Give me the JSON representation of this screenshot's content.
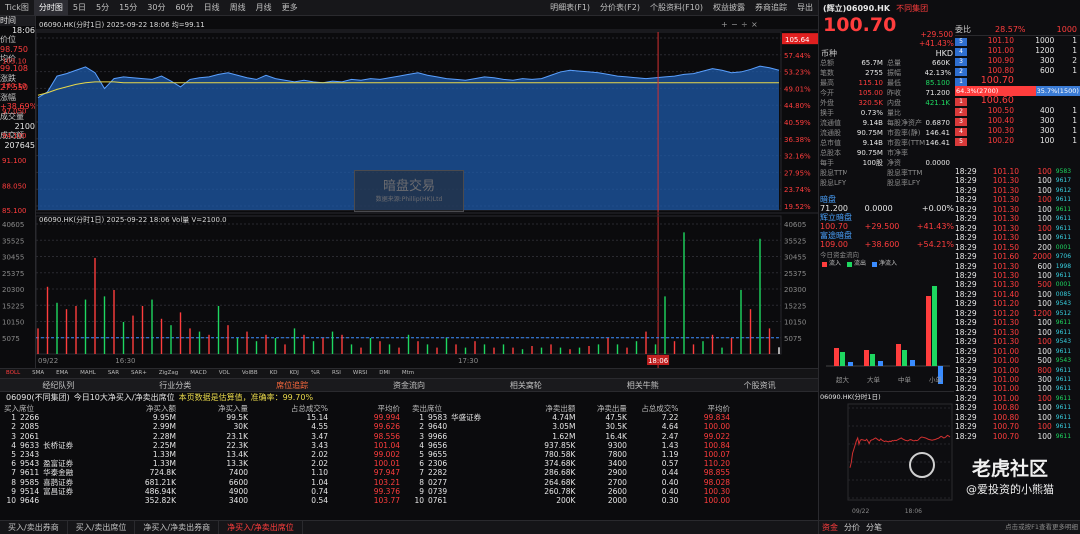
{
  "topbar": {
    "left": [
      "Tick图",
      "分时图",
      "5日",
      "5分",
      "15分",
      "30分",
      "60分",
      "日线",
      "周线",
      "月线",
      "更多"
    ],
    "right": [
      "明细表(F1)",
      "分价表(F2)",
      "个股资料(F10)",
      "权益披露",
      "券商追踪",
      "导出"
    ]
  },
  "sidebar": {
    "time": "时间",
    "price_label": "价位",
    "price": "98.750",
    "avg_label": "均价",
    "avg": "99.108",
    "change_label": "涨跌",
    "change": "27.550",
    "pct_label": "涨幅",
    "pct": "+38.69%",
    "vol_label": "成交量",
    "vol": "2100",
    "amt_label": "成交额",
    "amt": "207645"
  },
  "chart_title": "06090.HK(分时1日) 2025-09-22 18:06 均=99.11",
  "chart_time": "18:06",
  "vol_title": "06090.HK(分时1日) 2025-09-22 18:06 Vol量 V=2100.0",
  "watermark": {
    "title": "暗盘交易",
    "sub": "数据来源:Phillip(HK)Ltd"
  },
  "chart_data": {
    "type": "line",
    "x_labels": [
      "09/22",
      "16:30",
      "17:30",
      "18:06"
    ],
    "price_ticks": [
      "85.100",
      "88.050",
      "91.100",
      "94.100",
      "97.050",
      "100.10",
      "103.10"
    ],
    "pct_ticks": [
      "61.66%",
      "57.44%",
      "53.23%",
      "49.01%",
      "44.80%",
      "40.59%",
      "36.38%",
      "32.16%",
      "27.95%",
      "23.74%",
      "19.52%"
    ],
    "vol_ticks": [
      "40605",
      "35525",
      "30455",
      "25375",
      "20300",
      "15225",
      "10150",
      "5075"
    ],
    "vol_ticks_left": [
      "40605",
      "35525",
      "30455",
      "25375",
      "20300",
      "15225",
      "10150",
      "5075"
    ],
    "last_price": "105.64",
    "ylim": [
      85.1,
      106.5
    ],
    "price": [
      98.6,
      99.3,
      101.2,
      101.5,
      101.9,
      102.3,
      101.6,
      99.7,
      100.9,
      101.1,
      101.0,
      100.9,
      100.8,
      101.2,
      100.6,
      99.9,
      100.8,
      101.0,
      101.1,
      101.4,
      101.6,
      101.3,
      101.0,
      100.8,
      101.3,
      100.9,
      100.7,
      100.5,
      100.7,
      100.5,
      100.4,
      100.6,
      100.5,
      100.8,
      100.7,
      100.9,
      100.8,
      101.0,
      101.2,
      101.4,
      101.6,
      101.3,
      101.1,
      100.9,
      100.8,
      100.7,
      100.9,
      101.1,
      101.0,
      100.8,
      100.7,
      100.9,
      100.8,
      100.9,
      101.3,
      101.7,
      101.9,
      101.8,
      101.7,
      101.6,
      101.4,
      101.2,
      101.1,
      101.0,
      100.9,
      101.0,
      101.1,
      101.2,
      101.4,
      101.5,
      101.8,
      102.1,
      101.9,
      101.6,
      101.7,
      102.0,
      102.4,
      102.2,
      101.9
    ],
    "avg": [
      98.9,
      99.2,
      99.6,
      99.9,
      100.2,
      100.4,
      100.5,
      100.5,
      100.5,
      100.4,
      100.4,
      100.4,
      100.4,
      100.4,
      100.4,
      100.4,
      100.4,
      100.4,
      100.4,
      100.4,
      100.4,
      100.4,
      100.4,
      100.4,
      100.4,
      100.4,
      100.4,
      100.4,
      100.4,
      100.4,
      100.4,
      100.4,
      100.4,
      100.4,
      100.4,
      100.4,
      100.4,
      100.4,
      100.4,
      100.4,
      100.4,
      100.4,
      100.4,
      100.4,
      100.4,
      100.4,
      100.4,
      100.4,
      100.4,
      100.4,
      100.4,
      100.4,
      100.4,
      100.4,
      100.4,
      100.4,
      100.4,
      100.4,
      100.4,
      100.4,
      100.4,
      100.4,
      100.4,
      100.4,
      100.4,
      100.4,
      100.4,
      100.4,
      100.4,
      100.4,
      100.4,
      100.4,
      100.4,
      100.4,
      100.4,
      100.4,
      100.4,
      100.4,
      100.4
    ],
    "volume": [
      8000,
      21000,
      16000,
      14000,
      15000,
      17000,
      30000,
      18000,
      20000,
      10000,
      12000,
      15000,
      17000,
      11000,
      9000,
      13000,
      8000,
      7000,
      6000,
      15000,
      9000,
      5000,
      7000,
      4000,
      6000,
      5000,
      3000,
      8000,
      6000,
      4000,
      5000,
      7000,
      6000,
      3000,
      2000,
      5000,
      4000,
      3000,
      2000,
      6000,
      4000,
      3000,
      2000,
      5000,
      3000,
      2000,
      4000,
      3000,
      2000,
      3000,
      2000,
      1500,
      2500,
      2000,
      3000,
      2000,
      1500,
      2000,
      2500,
      3000,
      5000,
      3000,
      2000,
      4000,
      7000,
      3000,
      18000,
      4000,
      38000,
      3000,
      4000,
      6000,
      2000,
      5000,
      20000,
      14000,
      36000,
      8000,
      2100
    ],
    "vol_up": [
      1,
      1,
      0,
      1,
      1,
      0,
      1,
      0,
      1,
      0,
      1,
      1,
      0,
      1,
      0,
      1,
      1,
      0,
      1,
      0,
      1,
      0,
      1,
      0,
      1,
      0,
      1,
      0,
      1,
      0,
      1,
      0,
      1,
      0,
      1,
      0,
      1,
      0,
      1,
      0,
      1,
      0,
      1,
      0,
      1,
      0,
      1,
      0,
      1,
      0,
      1,
      0,
      1,
      0,
      1,
      0,
      1,
      0,
      1,
      0,
      1,
      0,
      1,
      0,
      1,
      0,
      0,
      1,
      0,
      1,
      0,
      1,
      0,
      1,
      0,
      1,
      0,
      1,
      1
    ]
  },
  "indicators": [
    "BOLL",
    "SMA",
    "EMA",
    "MAHL",
    "SAR",
    "SAR+",
    "ZigZag",
    "MACD",
    "VOL",
    "VolBB",
    "KD",
    "KDJ",
    "%R",
    "RSI",
    "WRSI",
    "DMI",
    "Mtm"
  ],
  "tabs2": [
    "经纪队列",
    "行业分类",
    "席位追踪",
    "资金流向",
    "相关窝轮",
    "相关牛熊",
    "个股资讯"
  ],
  "broker_header": {
    "prefix": "06090(不同集团)",
    "mid": "今日10大净买入/净卖出席位",
    "note": "本页数据是估算值，准确率：",
    "rate": "99.70%"
  },
  "buy_table": {
    "headers": [
      "买入席位",
      "净买入额",
      "净买入量",
      "占总成交%",
      "平均价"
    ],
    "rows": [
      [
        "1",
        "2266",
        "",
        "9.95M",
        "99.5K",
        "15.14",
        "99.994"
      ],
      [
        "2",
        "2085",
        "",
        "2.99M",
        "30K",
        "4.55",
        "99.626"
      ],
      [
        "3",
        "2061",
        "",
        "2.28M",
        "23.1K",
        "3.47",
        "98.556"
      ],
      [
        "4",
        "9633",
        "长桥证券",
        "2.25M",
        "22.3K",
        "3.43",
        "101.04"
      ],
      [
        "5",
        "2343",
        "",
        "1.33M",
        "13.4K",
        "2.02",
        "99.002"
      ],
      [
        "6",
        "9543",
        "盈富证券",
        "1.33M",
        "13.3K",
        "2.02",
        "100.01"
      ],
      [
        "7",
        "9611",
        "华泰金融",
        "724.8K",
        "7400",
        "1.10",
        "97.947"
      ],
      [
        "8",
        "9585",
        "喜鹊证券",
        "681.21K",
        "6600",
        "1.04",
        "103.21"
      ],
      [
        "9",
        "9514",
        "富昌证券",
        "486.94K",
        "4900",
        "0.74",
        "99.376"
      ],
      [
        "10",
        "9646",
        "",
        "352.82K",
        "3400",
        "0.54",
        "103.77"
      ]
    ]
  },
  "sell_table": {
    "headers": [
      "卖出席位",
      "净卖出额",
      "净卖出量",
      "占总成交%",
      "平均价"
    ],
    "rows": [
      [
        "1",
        "9583",
        "华盛证券",
        "4.74M",
        "47.5K",
        "7.22",
        "99.834"
      ],
      [
        "2",
        "9640",
        "",
        "3.05M",
        "30.5K",
        "4.64",
        "100.00"
      ],
      [
        "3",
        "9966",
        "",
        "1.62M",
        "16.4K",
        "2.47",
        "99.022"
      ],
      [
        "4",
        "9656",
        "",
        "937.85K",
        "9300",
        "1.43",
        "100.84"
      ],
      [
        "5",
        "9655",
        "",
        "780.58K",
        "7800",
        "1.19",
        "100.07"
      ],
      [
        "6",
        "2306",
        "",
        "374.68K",
        "3400",
        "0.57",
        "110.20"
      ],
      [
        "7",
        "2282",
        "",
        "286.68K",
        "2900",
        "0.44",
        "98.855"
      ],
      [
        "8",
        "0277",
        "",
        "264.68K",
        "2700",
        "0.40",
        "98.028"
      ],
      [
        "9",
        "0739",
        "",
        "260.78K",
        "2600",
        "0.40",
        "100.30"
      ],
      [
        "10",
        "0761",
        "",
        "200K",
        "2000",
        "0.30",
        "100.00"
      ]
    ]
  },
  "bottom_tabs": [
    "买入/卖出券商",
    "买入/卖出席位",
    "净买入/净卖出券商",
    "净买入/净卖出席位"
  ],
  "quote": {
    "name": "(辉立)06090.HK",
    "group": "不同集团",
    "price": "100.70",
    "chg": "+29.500",
    "pct": "+41.43%",
    "currency_label": "币种",
    "currency": "HKD",
    "stats": [
      [
        "总额",
        "65.7M",
        "总量",
        "660K"
      ],
      [
        "笔数",
        "2755",
        "振幅",
        "42.13%"
      ],
      [
        "最高",
        "115.10",
        "最低",
        "85.100"
      ],
      [
        "今开",
        "105.00",
        "昨收",
        "71.200"
      ],
      [
        "外盘",
        "320.5K",
        "内盘",
        "421.1K"
      ],
      [
        "换手",
        "0.73%",
        "量比",
        ""
      ],
      [
        "流通值",
        "9.14B",
        "每股净资产",
        "0.6870"
      ],
      [
        "流通股",
        "90.75M",
        "市盈率(静)",
        "146.41"
      ],
      [
        "总市值",
        "9.14B",
        "市盈率(TTM)",
        "146.41"
      ],
      [
        "总股本",
        "90.75M",
        "市净率",
        ""
      ],
      [
        "每手",
        "100股",
        "净资",
        "0.0000"
      ],
      [
        "股息TTM",
        "",
        "股息率TTM",
        ""
      ],
      [
        "股息LFY",
        "",
        "股息率LFY",
        ""
      ]
    ]
  },
  "dark": {
    "h1": "暗盘",
    "r1": [
      "71.200",
      "0.0000",
      "+0.00%"
    ],
    "h2": "辉立暗盘",
    "r2": [
      "100.70",
      "+29.500",
      "+41.43%"
    ],
    "h3": "富途暗盘",
    "r3": [
      "109.00",
      "+38.600",
      "+54.21%"
    ]
  },
  "flow": {
    "title": "今日资金流向",
    "legend": [
      "流入",
      "流出",
      "净流入"
    ],
    "labels": [
      "超大",
      "大单",
      "中单",
      "小单"
    ]
  },
  "mini_title": "06090.HK(分时1日)",
  "mini_x": [
    "09/22",
    "18:06"
  ],
  "orderbook": {
    "sell_label": "委比",
    "sell_pct": "28.57%",
    "sell_diff": "1000",
    "asks": [
      [
        "5",
        "101.10",
        "1000",
        "1"
      ],
      [
        "4",
        "101.00",
        "1200",
        "1"
      ],
      [
        "3",
        "100.90",
        "300",
        "2"
      ],
      [
        "2",
        "100.80",
        "600",
        "1"
      ],
      [
        "1",
        "100.70",
        "",
        ""
      ]
    ],
    "bid_pct": "64.3%(2700)",
    "ask_pct": "35.7%(1500)",
    "bids": [
      [
        "1",
        "100.60",
        "",
        ""
      ],
      [
        "2",
        "100.50",
        "400",
        "1"
      ],
      [
        "3",
        "100.40",
        "300",
        "1"
      ],
      [
        "4",
        "100.30",
        "300",
        "1"
      ],
      [
        "5",
        "100.20",
        "100",
        "1"
      ]
    ]
  },
  "ticks": [
    [
      "18:29",
      "101.10",
      "100",
      "9583"
    ],
    [
      "18:29",
      "101.30",
      "100",
      "9617"
    ],
    [
      "18:29",
      "101.30",
      "100",
      "9612"
    ],
    [
      "18:29",
      "101.30",
      "100",
      "9611"
    ],
    [
      "18:29",
      "101.30",
      "100",
      "9611"
    ],
    [
      "18:29",
      "101.30",
      "100",
      "9611"
    ],
    [
      "18:29",
      "101.30",
      "100",
      "9611"
    ],
    [
      "18:29",
      "101.30",
      "100",
      "9611"
    ],
    [
      "18:29",
      "101.50",
      "200",
      "0001"
    ],
    [
      "18:29",
      "101.60",
      "2000",
      "9706"
    ],
    [
      "18:29",
      "101.30",
      "600",
      "1998"
    ],
    [
      "18:29",
      "101.30",
      "100",
      "9611"
    ],
    [
      "18:29",
      "101.30",
      "500",
      "0001"
    ],
    [
      "18:29",
      "101.40",
      "100",
      "0085"
    ],
    [
      "18:29",
      "101.20",
      "100",
      "9543"
    ],
    [
      "18:29",
      "101.20",
      "1200",
      "9512"
    ],
    [
      "18:29",
      "101.30",
      "100",
      "9611"
    ],
    [
      "18:29",
      "101.30",
      "100",
      "9611"
    ],
    [
      "18:29",
      "101.30",
      "100",
      "9543"
    ],
    [
      "18:29",
      "101.00",
      "100",
      "9611"
    ],
    [
      "18:29",
      "101.00",
      "500",
      "9543"
    ],
    [
      "18:29",
      "101.00",
      "800",
      "9611"
    ],
    [
      "18:29",
      "101.00",
      "300",
      "9611"
    ],
    [
      "18:29",
      "101.00",
      "100",
      "9611"
    ],
    [
      "18:29",
      "101.00",
      "100",
      "9611"
    ],
    [
      "18:29",
      "100.80",
      "100",
      "9611"
    ],
    [
      "18:29",
      "100.80",
      "100",
      "9611"
    ],
    [
      "18:29",
      "100.70",
      "100",
      "9611"
    ],
    [
      "18:29",
      "100.70",
      "100",
      "9611"
    ]
  ],
  "right_bottom_tabs": [
    "资金",
    "分价",
    "分笔"
  ],
  "right_bottom_note": "点击或按F1查看更多明细",
  "watermark2": {
    "brand": "老虎社区",
    "user": "@爱投资的小熊猫"
  }
}
